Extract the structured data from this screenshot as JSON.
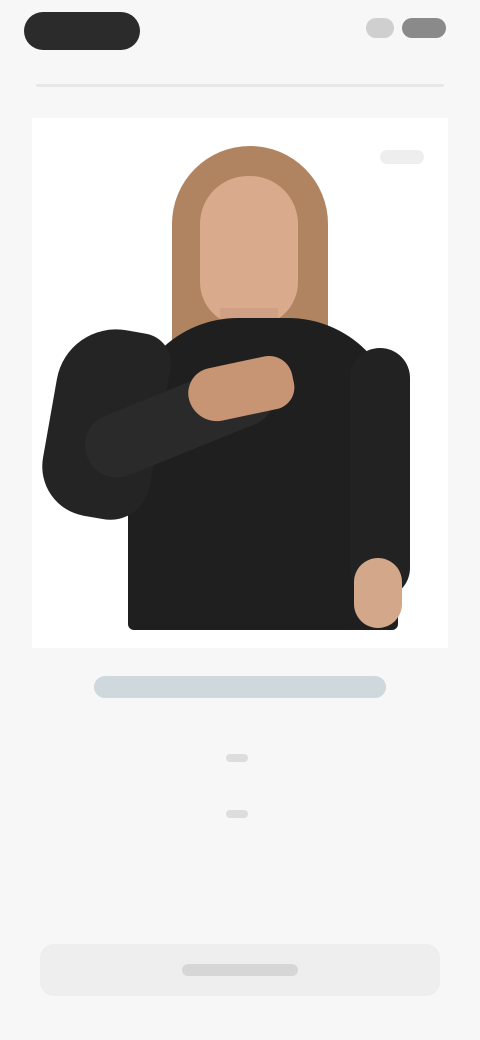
{
  "header": {
    "logo_label": "",
    "right_actions": [
      "",
      ""
    ]
  },
  "video": {
    "badge_label": "",
    "caption": ""
  },
  "meta": {
    "line1": "",
    "line2": ""
  },
  "footer": {
    "button_label": ""
  },
  "colors": {
    "background": "#f7f7f7",
    "card": "#ffffff",
    "logo": "#2b2b2b",
    "caption_bar": "#cfd8dc"
  },
  "icons": {
    "logo": "brand-logo-icon"
  }
}
